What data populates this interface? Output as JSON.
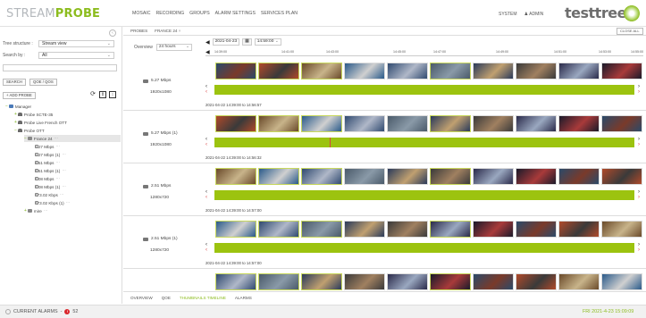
{
  "app": {
    "logo_part1": "STREAM",
    "logo_part2": "PROBE",
    "brand": "testtree",
    "accent": "#8cbc1e"
  },
  "nav": {
    "items": [
      "MOSAIC",
      "RECORDING",
      "GROUPS",
      "ALARM SETTINGS",
      "SERVICES PLAN"
    ],
    "system": "SYSTEM",
    "admin": "ADMIN"
  },
  "sidebar": {
    "tree_structure_label": "Tree structure :",
    "tree_structure_value": "Stream view",
    "search_by_label": "Search by :",
    "search_by_value": "All",
    "search_placeholder": "",
    "search_button": "SEARCH",
    "qoe_qos_button": "QOE / QOS",
    "add_probe_button": "ADD PROBE",
    "tree": [
      {
        "label": "Manager",
        "level": 0,
        "type": "server"
      },
      {
        "label": "Probe SCTE-35",
        "level": 1,
        "type": "probe"
      },
      {
        "label": "Probe Live French OTT",
        "level": 1,
        "type": "probe"
      },
      {
        "label": "Probe OTT",
        "level": 1,
        "type": "probe"
      },
      {
        "label": "France 24",
        "level": 2,
        "type": "channel",
        "selected": true
      },
      {
        "label": "5.27 Mbps",
        "level": 3,
        "type": "stream"
      },
      {
        "label": "5.27 Mbps (1)",
        "level": 3,
        "type": "stream"
      },
      {
        "label": "2.51 Mbps",
        "level": 3,
        "type": "stream"
      },
      {
        "label": "2.51 Mbps (1)",
        "level": 3,
        "type": "stream"
      },
      {
        "label": "1.08 Mbps",
        "level": 3,
        "type": "stream"
      },
      {
        "label": "1.08 Mbps (1)",
        "level": 3,
        "type": "stream"
      },
      {
        "label": "673.02 Kbps",
        "level": 3,
        "type": "stream"
      },
      {
        "label": "673.02 Kbps (1)",
        "level": 3,
        "type": "stream"
      },
      {
        "label": "mire",
        "level": 2,
        "type": "channel"
      }
    ]
  },
  "tabs": {
    "probes": "PROBES",
    "france24": "FRANCE 24",
    "close_all": "CLOSE ALL"
  },
  "overview": {
    "label": "Overview",
    "period": "24 hours",
    "date": "2021-04-23",
    "time": "14:59:00",
    "ticks": [
      "14:39:00",
      "14:41:00",
      "14:43:00",
      "14:45:00",
      "14:47:00",
      "14:49:00",
      "14:51:00",
      "14:53:00",
      "14:55:00"
    ]
  },
  "streams": [
    {
      "rate": "5.27 Mbps",
      "resolution": "1920x1080",
      "range": "2021-04-22 14:39:00 to 14:56:57",
      "red_marks": []
    },
    {
      "rate": "5.27 Mbps (1)",
      "resolution": "1920x1080",
      "range": "2021-04-22 14:39:00 to 14:56:32",
      "red_marks": [
        0.275
      ]
    },
    {
      "rate": "2.51 Mbps",
      "resolution": "1280x720",
      "range": "2021-04-22 14:39:00 to 14:57:00",
      "red_marks": []
    },
    {
      "rate": "2.51 Mbps (1)",
      "resolution": "1280x720",
      "range": "2021-04-22 14:39:00 to 14:57:00",
      "red_marks": []
    },
    {
      "rate": "",
      "resolution": "",
      "range": "",
      "red_marks": []
    }
  ],
  "bottom_tabs": [
    "OVERVIEW",
    "QOE",
    "THUMBNAILS TIMELINE",
    "ALARMS"
  ],
  "bottom_active": "THUMBNAILS TIMELINE",
  "status": {
    "alarms_label": "CURRENT ALARMS",
    "alarms_count": "52",
    "clock": "FRI 2021-4-23 15:09:09"
  }
}
